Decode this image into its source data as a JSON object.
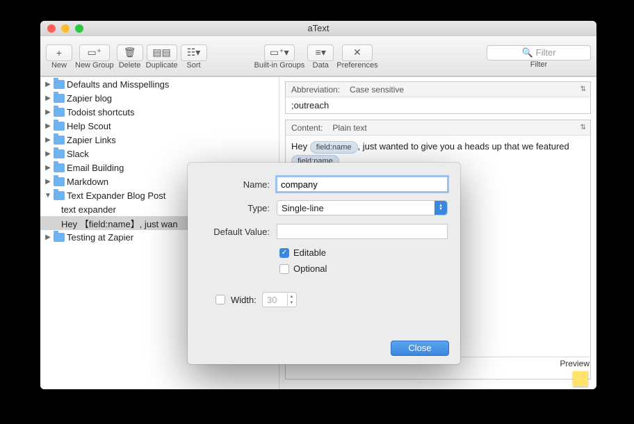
{
  "title": "aText",
  "toolbar": {
    "new": "New",
    "new_group": "New Group",
    "delete": "Delete",
    "duplicate": "Duplicate",
    "sort": "Sort",
    "builtin": "Built-in Groups",
    "data": "Data",
    "prefs": "Preferences",
    "filter_label": "Filter",
    "filter_placeholder": "Filter"
  },
  "sidebar": [
    {
      "label": "Defaults and Misspellings",
      "disclosure": "▶",
      "folder": true
    },
    {
      "label": "Zapier blog",
      "disclosure": "▶",
      "folder": true
    },
    {
      "label": "Todoist shortcuts",
      "disclosure": "▶",
      "folder": true
    },
    {
      "label": "Help Scout",
      "disclosure": "▶",
      "folder": true
    },
    {
      "label": "Zapier Links",
      "disclosure": "▶",
      "folder": true
    },
    {
      "label": "Slack",
      "disclosure": "▶",
      "folder": true
    },
    {
      "label": "Email Building",
      "disclosure": "▶",
      "folder": true
    },
    {
      "label": "Markdown",
      "disclosure": "▶",
      "folder": true
    },
    {
      "label": "Text Expander Blog Post",
      "disclosure": "▼",
      "folder": true,
      "expanded": true,
      "children": [
        {
          "label": "text expander"
        },
        {
          "label": "Hey 【field:name】, just wan",
          "selected": true
        }
      ]
    },
    {
      "label": "Testing at Zapier",
      "disclosure": "▶",
      "folder": true
    }
  ],
  "rightpane": {
    "abbreviation_label": "Abbreviation:",
    "abbreviation_mode": "Case sensitive",
    "abbreviation_value": ";outreach",
    "content_label": "Content:",
    "content_mode": "Plain text",
    "content_prefix": "Hey ",
    "token1": "field:name",
    "content_mid": ", just wanted to give you a heads up that we featured ",
    "token2": "field:name",
    "preview": "Preview"
  },
  "modal": {
    "name_label": "Name:",
    "name_value": "company",
    "type_label": "Type:",
    "type_value": "Single-line",
    "default_label": "Default Value:",
    "default_value": "",
    "editable": "Editable",
    "optional": "Optional",
    "width_label": "Width:",
    "width_value": "30",
    "close": "Close"
  }
}
